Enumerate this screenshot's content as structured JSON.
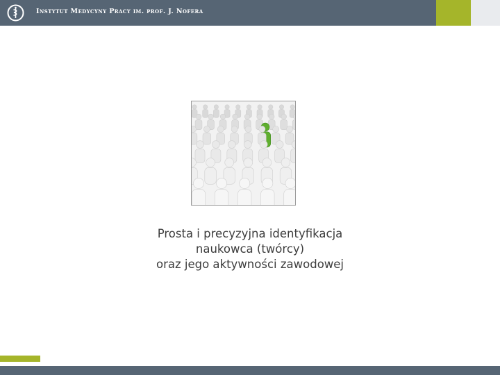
{
  "header": {
    "institution_name": "Instytut Medycyny Pracy im. prof. J. Nofera",
    "logo_icon": "institute-logo-icon",
    "bar_color": "#566574",
    "accent_color": "#a5b52a"
  },
  "slide": {
    "image_icon": "crowd-green-person-icon",
    "title_lines": [
      "Prosta i precyzyjna identyfikacja",
      "naukowca (twórcy)",
      "oraz jego aktywności zawodowej"
    ]
  }
}
